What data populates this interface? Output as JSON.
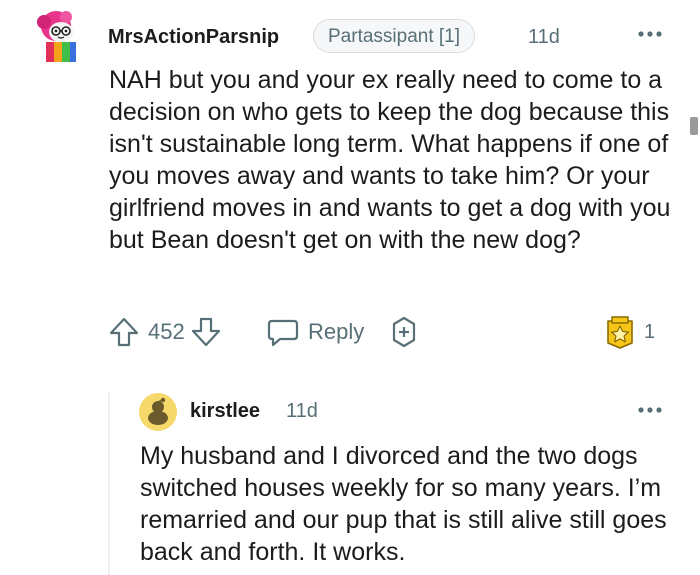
{
  "comment": {
    "author": "MrsActionParsnip",
    "flair": "Partassipant [1]",
    "age": "11d",
    "body": "NAH but you and your ex really need to come to a decision on who gets to keep the dog because this isn't sustainable long term. What happens if one of you moves away and wants to take him? Or your girlfriend moves in and wants to get a dog with you but Bean doesn't get on with the new dog?",
    "score": "452",
    "reply_label": "Reply",
    "award_count": "1",
    "icons": {
      "avatar": "snoo-avatar-icon",
      "more": "more-options-icon",
      "upvote": "upvote-arrow-icon",
      "downvote": "downvote-arrow-icon",
      "reply": "reply-bubble-icon",
      "award_add": "add-award-icon",
      "award_badge": "award-badge-icon"
    }
  },
  "reply": {
    "author": "kirstlee",
    "age": "11d",
    "body": "My husband and I divorced and the two dogs switched houses weekly for so many years. I’m remarried and our pup that is still alive still goes back and forth. It works.",
    "icons": {
      "avatar": "default-snoo-avatar-icon",
      "more": "more-options-icon"
    }
  },
  "colors": {
    "text": "#1c1c1c",
    "meta": "#576f76",
    "flair_bg": "#f6f7f8",
    "award_gold": "#f5c518",
    "reply_avatar_bg": "#f7d86a"
  }
}
